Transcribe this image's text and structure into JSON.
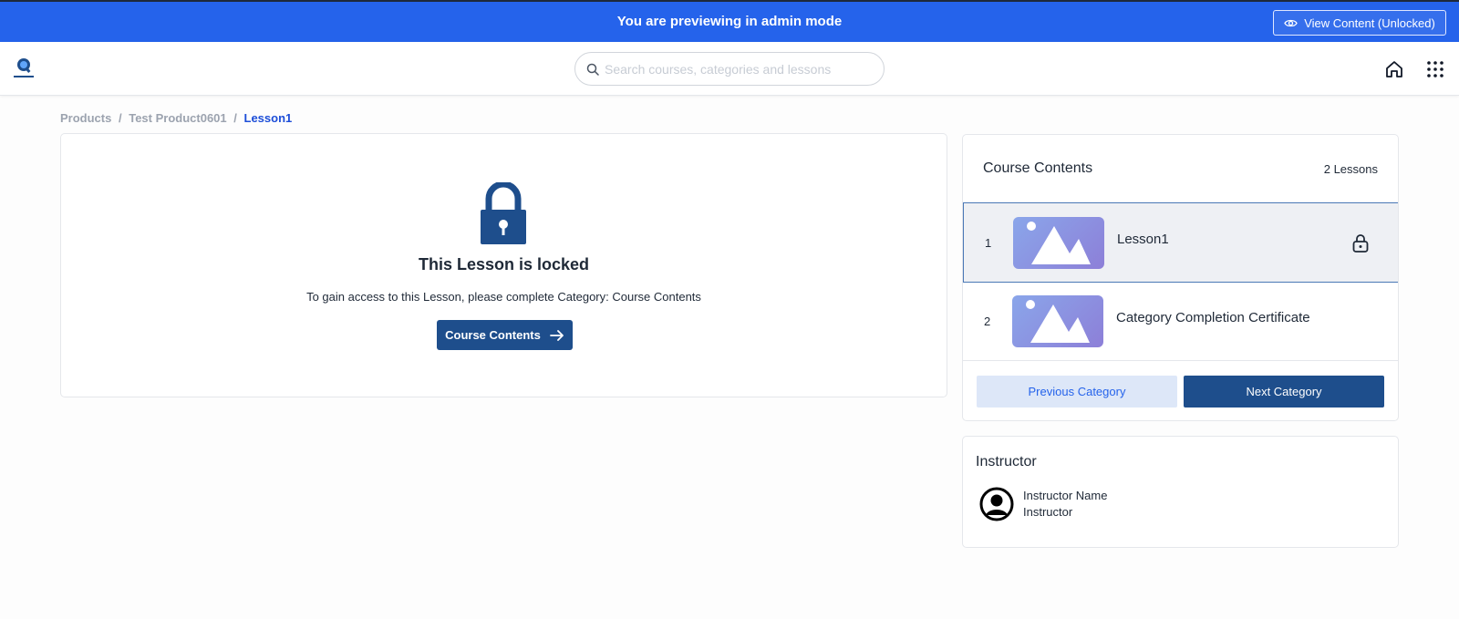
{
  "admin_bar": {
    "message": "You are previewing in admin mode",
    "view_button_label": "View Content (Unlocked)"
  },
  "header": {
    "search_placeholder": "Search courses, categories and lessons",
    "icons": [
      "search-icon",
      "home-icon",
      "apps-grid-icon"
    ]
  },
  "breadcrumb": {
    "items": [
      "Products",
      "Test Product0601"
    ],
    "current": "Lesson1",
    "separator": "/"
  },
  "locked": {
    "title": "This Lesson is locked",
    "description": "To gain access to this Lesson, please complete Category: Course Contents",
    "button_label": "Course Contents"
  },
  "course_contents": {
    "title": "Course Contents",
    "count_label": "2 Lessons",
    "lessons": [
      {
        "number": "1",
        "title": "Lesson1",
        "locked": true,
        "active": true
      },
      {
        "number": "2",
        "title": "Category Completion Certificate",
        "locked": false,
        "active": false
      }
    ],
    "prev_label": "Previous Category",
    "next_label": "Next Category"
  },
  "instructor": {
    "title": "Instructor",
    "name": "Instructor Name",
    "role": "Instructor"
  },
  "colors": {
    "admin_bar": "#2563eb",
    "primary": "#1e4e8c",
    "link": "#1d4ed8",
    "secondary_button": "#dde7f8"
  }
}
